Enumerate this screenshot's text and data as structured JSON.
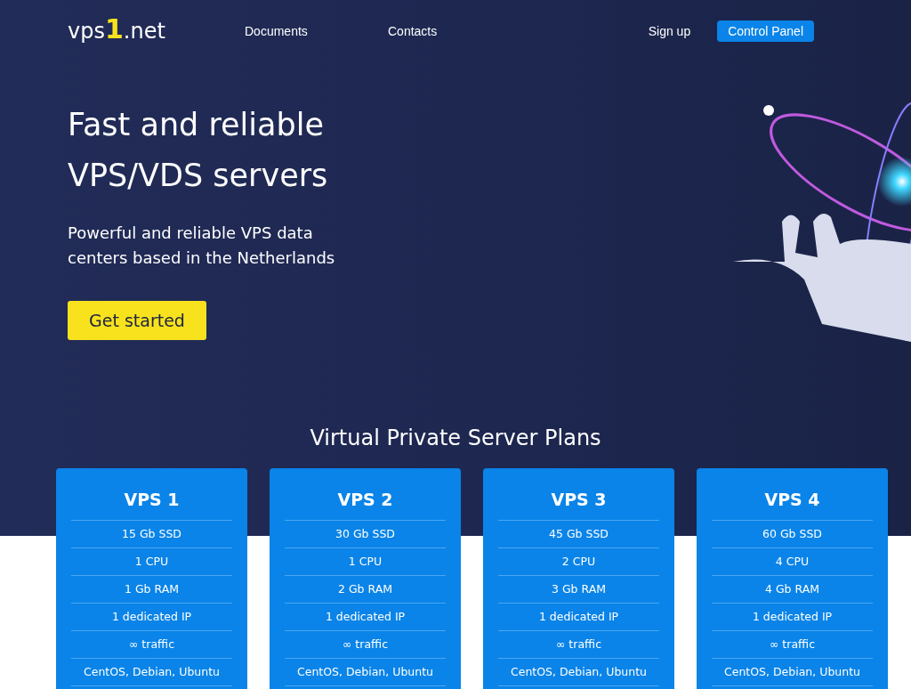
{
  "logo": {
    "prefix": "vps",
    "accent": "1",
    "suffix": ".net"
  },
  "nav": {
    "links": [
      "Documents",
      "Contacts"
    ],
    "sign_up": "Sign up",
    "control_panel": "Control Panel"
  },
  "hero": {
    "title_lines": [
      "Fast and reliable",
      "VPS/VDS servers"
    ],
    "subtitle_lines": [
      "Powerful and reliable VPS data",
      "centers based in the Netherlands"
    ],
    "cta": "Get started"
  },
  "plans_heading": "Virtual Private Server Plans",
  "plans": [
    {
      "name": "VPS 1",
      "features": [
        "15 Gb SSD",
        "1 CPU",
        "1 Gb RAM",
        "1 dedicated IP",
        "∞ traffic",
        "CentOS, Debian, Ubuntu"
      ]
    },
    {
      "name": "VPS 2",
      "features": [
        "30 Gb SSD",
        "1 CPU",
        "2 Gb RAM",
        "1 dedicated IP",
        "∞ traffic",
        "CentOS, Debian, Ubuntu"
      ]
    },
    {
      "name": "VPS 3",
      "features": [
        "45 Gb SSD",
        "2 CPU",
        "3 Gb RAM",
        "1 dedicated IP",
        "∞ traffic",
        "CentOS, Debian, Ubuntu"
      ]
    },
    {
      "name": "VPS 4",
      "features": [
        "60 Gb SSD",
        "4 CPU",
        "4 Gb RAM",
        "1 dedicated IP",
        "∞ traffic",
        "CentOS, Debian, Ubuntu"
      ]
    }
  ]
}
